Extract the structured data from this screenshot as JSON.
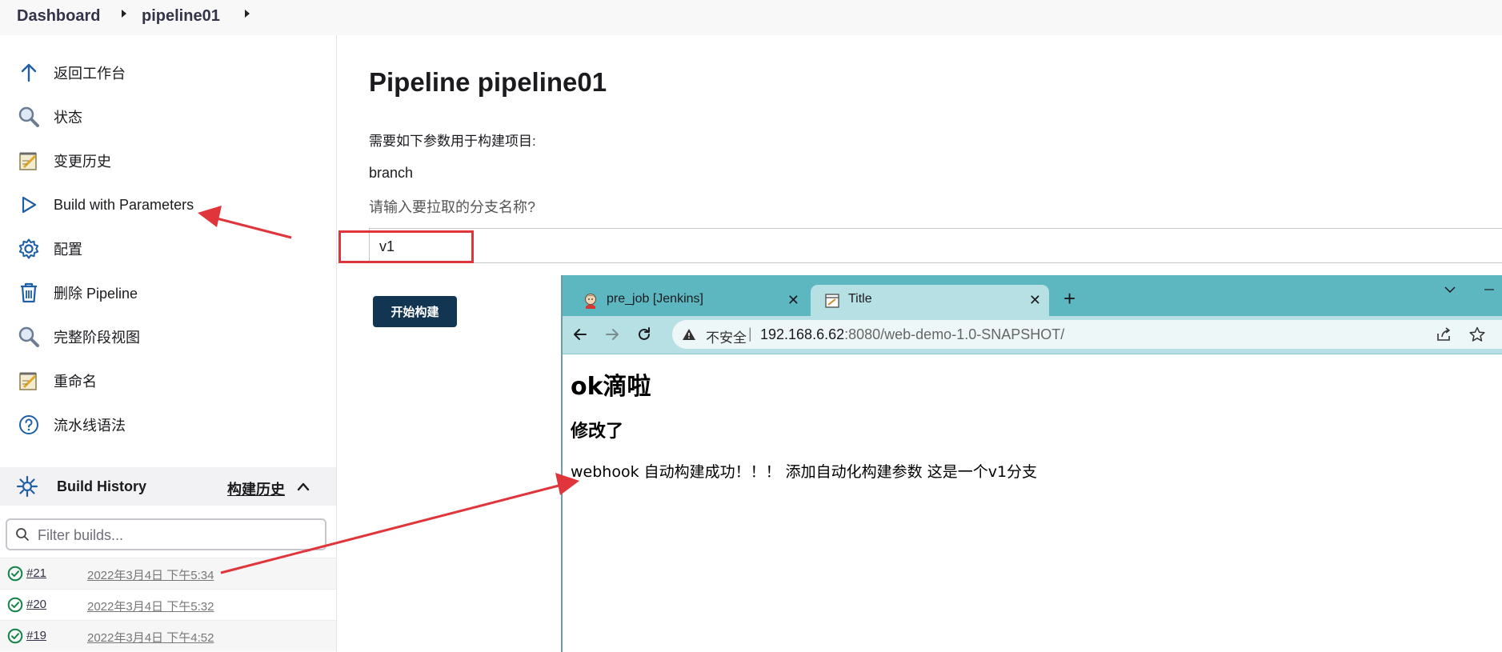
{
  "breadcrumb": {
    "items": [
      "Dashboard",
      "pipeline01"
    ]
  },
  "sidebar": {
    "items": [
      {
        "label": "返回工作台",
        "icon": "arrow-up-icon"
      },
      {
        "label": "状态",
        "icon": "magnifier-icon"
      },
      {
        "label": "变更历史",
        "icon": "notepad-icon"
      },
      {
        "label": "Build with Parameters",
        "icon": "play-icon"
      },
      {
        "label": "配置",
        "icon": "gear-icon"
      },
      {
        "label": "删除 Pipeline",
        "icon": "trash-icon"
      },
      {
        "label": "完整阶段视图",
        "icon": "magnifier-icon"
      },
      {
        "label": "重命名",
        "icon": "notepad-icon"
      },
      {
        "label": "流水线语法",
        "icon": "help-icon"
      }
    ]
  },
  "build_history": {
    "title": "Build History",
    "title_cn": "构建历史",
    "filter_placeholder": "Filter builds...",
    "builds": [
      {
        "number": "#21",
        "date": "2022年3月4日 下午5:34",
        "status": "success"
      },
      {
        "number": "#20",
        "date": "2022年3月4日 下午5:32",
        "status": "success"
      },
      {
        "number": "#19",
        "date": "2022年3月4日 下午4:52",
        "status": "success"
      }
    ]
  },
  "main": {
    "title": "Pipeline pipeline01",
    "form_desc": "需要如下参数用于构建项目:",
    "param_name": "branch",
    "param_desc": "请输入要拉取的分支名称?",
    "param_value": "v1",
    "build_button": "开始构建"
  },
  "browser": {
    "tabs": [
      {
        "label": "pre_job [Jenkins]",
        "active": false,
        "icon": "jenkins-icon"
      },
      {
        "label": "Title",
        "active": true,
        "icon": "page-icon"
      }
    ],
    "address": {
      "security_label": "不安全",
      "separator": "|",
      "host": "192.168.6.62",
      "path": ":8080/web-demo-1.0-SNAPSHOT/"
    },
    "page": {
      "h1": "ok滴啦",
      "h3": "修改了",
      "p": "webhook 自动构建成功！！！ 添加自动化构建参数 这是一个v1分支"
    }
  },
  "colors": {
    "annotation": "#e0353b",
    "tab_strip": "#5db7c0",
    "toolbar": "#b7e0e4",
    "build_button": "#123652",
    "success": "#138347",
    "icon_blue": "#1f5fa8"
  }
}
